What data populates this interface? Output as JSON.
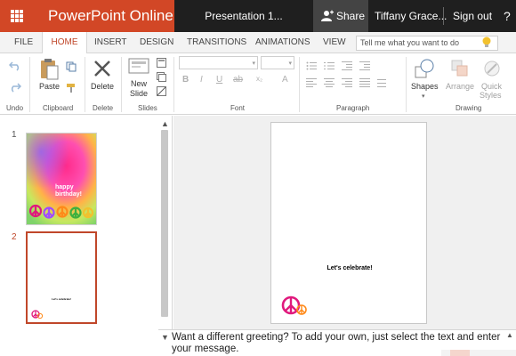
{
  "titlebar": {
    "app_name": "PowerPoint Online",
    "doc_title": "Presentation 1...",
    "share_label": "Share",
    "user_name": "Tiffany Grace...",
    "sign_out": "Sign out",
    "help": "?"
  },
  "tabs": [
    "FILE",
    "HOME",
    "INSERT",
    "DESIGN",
    "TRANSITIONS",
    "ANIMATIONS",
    "VIEW"
  ],
  "active_tab": "HOME",
  "tell_me": {
    "placeholder": "Tell me what you want to do"
  },
  "ribbon": {
    "groups": {
      "undo": "Undo",
      "clipboard": "Clipboard",
      "delete": "Delete",
      "slides": "Slides",
      "font": "Font",
      "paragraph": "Paragraph",
      "drawing": "Drawing"
    },
    "paste": "Paste",
    "delete_btn": "Delete",
    "new_slide_1": "New",
    "new_slide_2": "Slide",
    "shapes": "Shapes",
    "arrange": "Arrange",
    "quick_styles_1": "Quick",
    "quick_styles_2": "Styles"
  },
  "slides": [
    {
      "number": "1",
      "text": "happy birthday!"
    },
    {
      "number": "2",
      "text": "Let's celebrate!"
    }
  ],
  "main_slide": {
    "text": "Let's celebrate!"
  },
  "notes": {
    "text": "Want a different greeting? To add your own, just select the text and enter your message."
  },
  "colors": {
    "accent": "#d24726",
    "titlebar": "#1f1f1f",
    "share": "#444444"
  }
}
